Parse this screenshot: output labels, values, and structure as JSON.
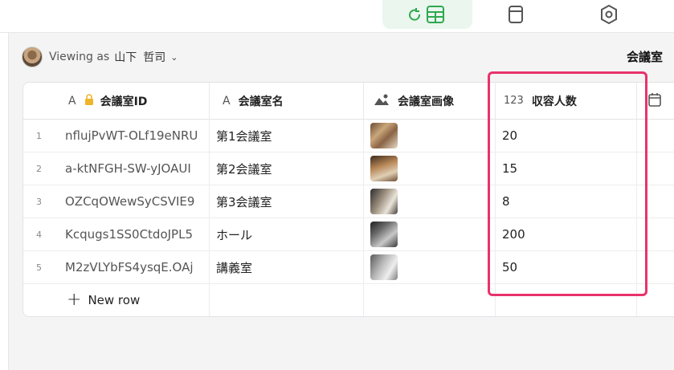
{
  "view_tabs": [
    "grid-view-icon",
    "card-view-icon",
    "settings-icon"
  ],
  "viewing": {
    "prefix": "Viewing as",
    "name": "山下",
    "name2": "哲司"
  },
  "table_title": "会議室",
  "columns": [
    {
      "type_icon": "A",
      "label": "会議室ID",
      "locked": true
    },
    {
      "type_icon": "A",
      "label": "会議室名"
    },
    {
      "type_icon": "image-icon",
      "label": "会議室画像"
    },
    {
      "type_icon": "123",
      "label": "収容人数"
    },
    {
      "type_icon": "calendar-icon",
      "label": ""
    }
  ],
  "rows": [
    {
      "num": "1",
      "id": "nflujPvWT-OLf19eNRU",
      "name": "第1会議室",
      "capacity": "20"
    },
    {
      "num": "2",
      "id": "a-ktNFGH-SW-yJOAUI",
      "name": "第2会議室",
      "capacity": "15"
    },
    {
      "num": "3",
      "id": "OZCqOWewSyCSVIE9",
      "name": "第3会議室",
      "capacity": "8"
    },
    {
      "num": "4",
      "id": "Kcqugs1SS0CtdoJPL5",
      "name": "ホール",
      "capacity": "200"
    },
    {
      "num": "5",
      "id": "M2zVLYbFS4ysqE.OAj",
      "name": "講義室",
      "capacity": "50"
    }
  ],
  "new_row_label": "New row",
  "colors": {
    "accent_green": "#2fa84f",
    "highlight": "#e8336b"
  }
}
